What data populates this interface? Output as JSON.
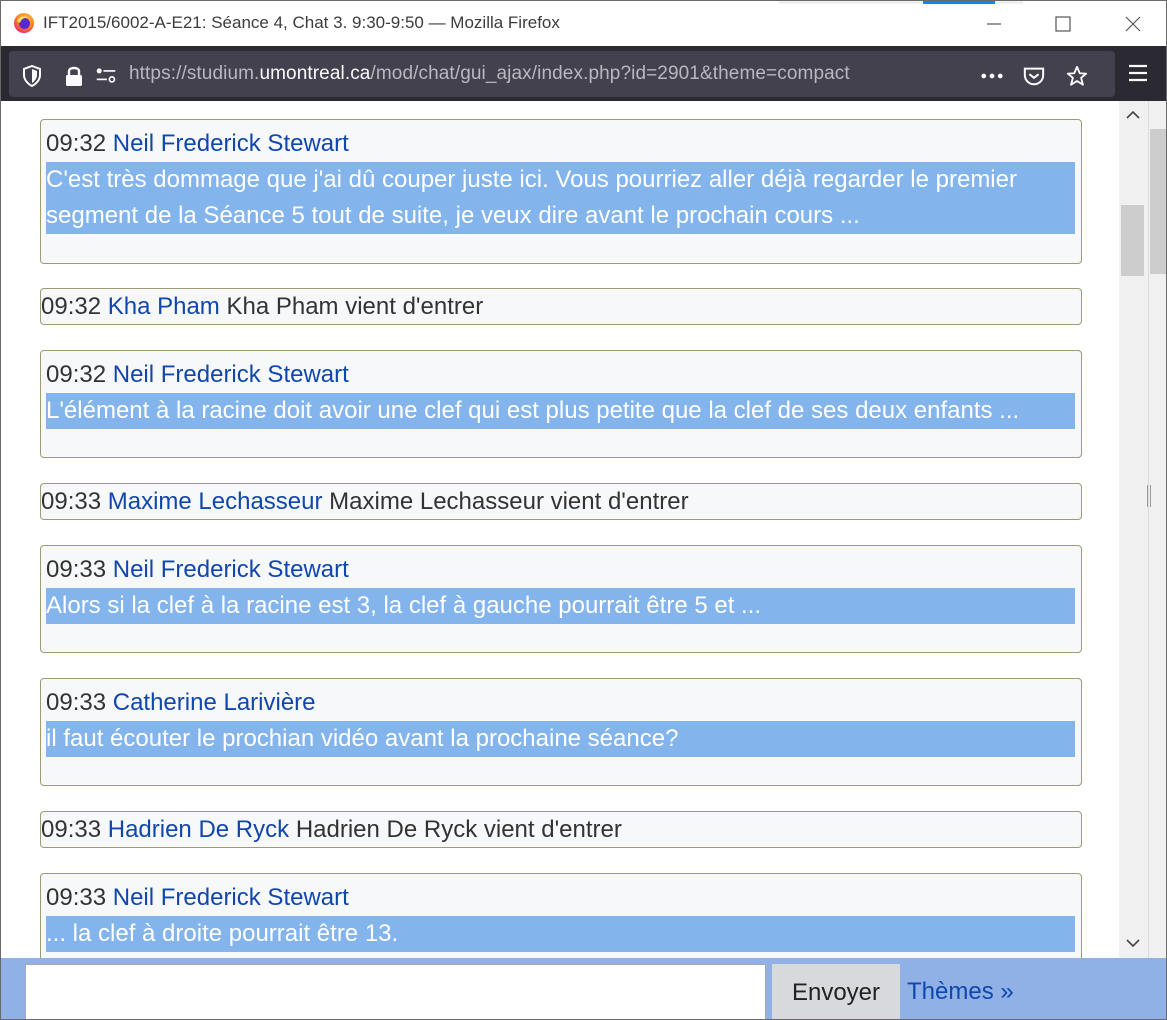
{
  "window": {
    "title": "IFT2015/6002-A-E21: Séance 4, Chat 3. 9:30-9:50 — Mozilla Firefox"
  },
  "navbar": {
    "url_prefix": "https://studium.",
    "url_domain": "umontreal.ca",
    "url_path": "/mod/chat/gui_ajax/index.php?id=2901&theme=compact",
    "icons": [
      "tracking-protection-icon",
      "lock-icon",
      "permissions-icon",
      "more-actions-icon",
      "pocket-icon",
      "bookmark-star-icon",
      "hamburger-menu-icon"
    ]
  },
  "messages": [
    {
      "type": "message",
      "time": "09:32",
      "user": "Neil Frederick Stewart",
      "lines": [
        "C'est très dommage que j'ai dû couper juste ici. Vous pourriez aller déjà regarder le premier",
        "segment de la Séance 5 tout de suite, je veux dire avant le prochain cours ..."
      ]
    },
    {
      "type": "system",
      "time": "09:32",
      "user": "Kha Pham",
      "text": "Kha Pham vient d'entrer"
    },
    {
      "type": "message",
      "time": "09:32",
      "user": "Neil Frederick Stewart",
      "lines": [
        "L'élément à la racine doit avoir une clef qui est plus petite que la clef de ses deux enfants ..."
      ]
    },
    {
      "type": "system",
      "time": "09:33",
      "user": "Maxime Lechasseur",
      "text": "Maxime Lechasseur vient d'entrer"
    },
    {
      "type": "message",
      "time": "09:33",
      "user": "Neil Frederick Stewart",
      "lines": [
        "Alors si la clef à la racine est 3, la clef à gauche pourrait être 5 et ..."
      ]
    },
    {
      "type": "message",
      "time": "09:33",
      "user": "Catherine Larivière",
      "lines": [
        "il faut écouter le prochian vidéo avant la prochaine séance?"
      ]
    },
    {
      "type": "system",
      "time": "09:33",
      "user": "Hadrien De Ryck",
      "text": "Hadrien De Ryck vient d'entrer"
    },
    {
      "type": "message",
      "time": "09:33",
      "user": "Neil Frederick Stewart",
      "lines": [
        "... la clef à droite pourrait être 13."
      ]
    }
  ],
  "composer": {
    "input_value": "",
    "send_label": "Envoyer",
    "themes_label": "Thèmes »"
  },
  "colors": {
    "username": "#0f47ad",
    "highlight": "#83b4ec",
    "input_bar": "#8fb1e6",
    "firefox_toolbar": "#2b2a33"
  }
}
